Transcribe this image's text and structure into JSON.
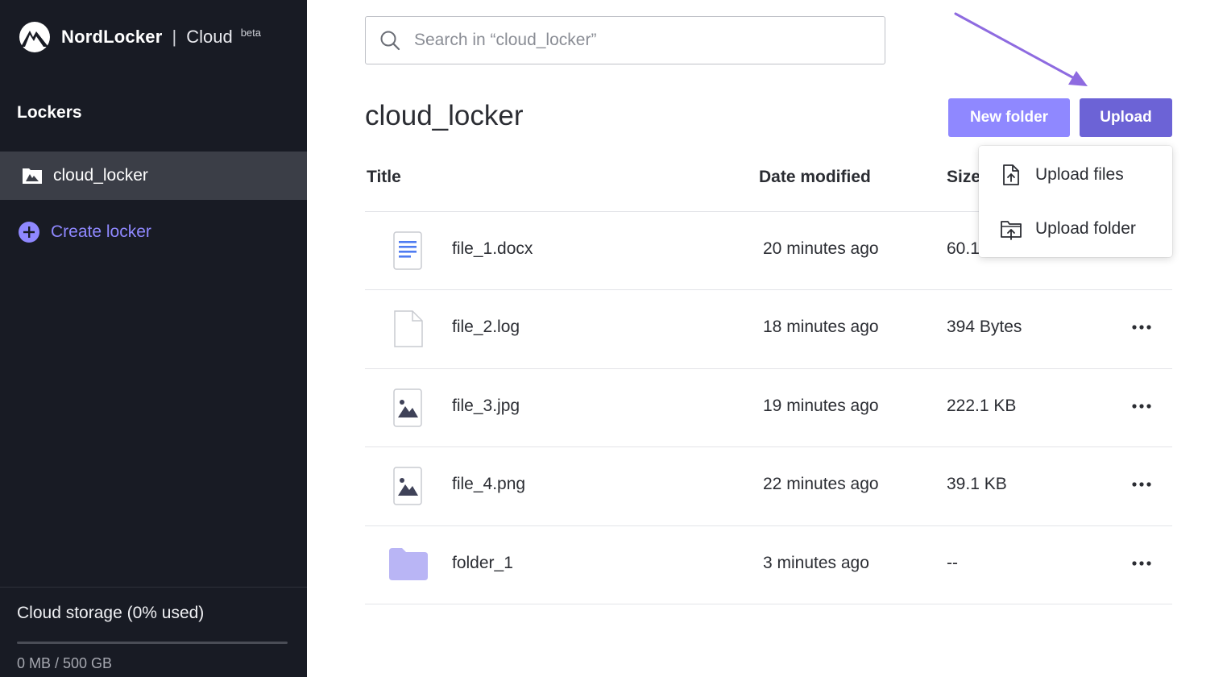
{
  "brand": {
    "name": "NordLocker",
    "separator": "|",
    "product": "Cloud",
    "badge": "beta"
  },
  "sidebar": {
    "section_title": "Lockers",
    "lockers": [
      {
        "label": "cloud_locker",
        "icon": "locker-icon"
      }
    ],
    "create_label": "Create locker",
    "storage": {
      "title": "Cloud storage (0% used)",
      "amount": "0 MB / 500 GB",
      "used_fraction": 0.0
    }
  },
  "search": {
    "placeholder": "Search in “cloud_locker”",
    "value": ""
  },
  "header": {
    "title": "cloud_locker",
    "new_folder_label": "New folder",
    "upload_label": "Upload"
  },
  "table": {
    "columns": {
      "title": "Title",
      "date": "Date modified",
      "size": "Size"
    },
    "rows": [
      {
        "name": "file_1.docx",
        "date": "20 minutes ago",
        "size": "60.1",
        "icon": "document-icon",
        "has_more": false
      },
      {
        "name": "file_2.log",
        "date": "18 minutes ago",
        "size": "394 Bytes",
        "icon": "file-icon",
        "has_more": true
      },
      {
        "name": "file_3.jpg",
        "date": "19 minutes ago",
        "size": "222.1 KB",
        "icon": "image-icon",
        "has_more": true
      },
      {
        "name": "file_4.png",
        "date": "22 minutes ago",
        "size": "39.1 KB",
        "icon": "image-icon",
        "has_more": true
      },
      {
        "name": "folder_1",
        "date": "3 minutes ago",
        "size": "--",
        "icon": "folder-icon",
        "has_more": true
      }
    ]
  },
  "upload_menu": {
    "items": [
      {
        "label": "Upload files",
        "icon": "upload-file-icon"
      },
      {
        "label": "Upload folder",
        "icon": "upload-folder-icon"
      }
    ]
  },
  "colors": {
    "sidebar_bg": "#181b24",
    "accent": "#8f88ff",
    "accent_dark": "#6c63d6",
    "folder": "#b9b5f5",
    "annotation_arrow": "#8e6be0"
  }
}
